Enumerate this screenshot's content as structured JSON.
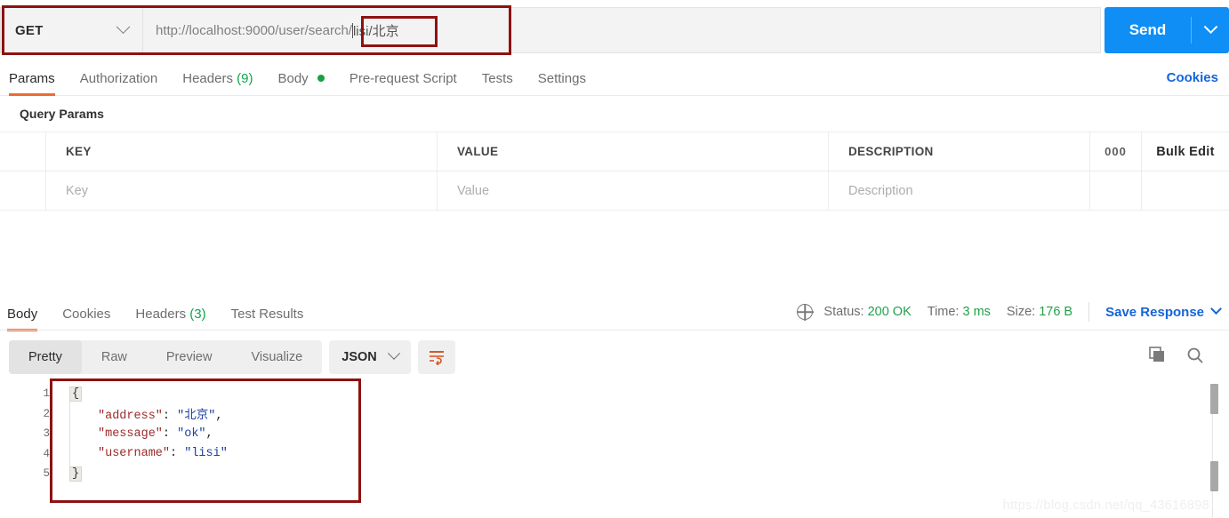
{
  "request": {
    "method": "GET",
    "url_prefix": "http://localhost:9000/user/search/",
    "url_highlight": "lisi/北京",
    "url_full": "http://localhost:9000/user/search/lisi/北京",
    "send_label": "Send",
    "cookies_label": "Cookies",
    "tabs": [
      {
        "label": "Params",
        "active": true,
        "count": "",
        "dot": false
      },
      {
        "label": "Authorization",
        "active": false,
        "count": "",
        "dot": false
      },
      {
        "label": "Headers",
        "active": false,
        "count": "(9)",
        "dot": false
      },
      {
        "label": "Body",
        "active": false,
        "count": "",
        "dot": true
      },
      {
        "label": "Pre-request Script",
        "active": false,
        "count": "",
        "dot": false
      },
      {
        "label": "Tests",
        "active": false,
        "count": "",
        "dot": false
      },
      {
        "label": "Settings",
        "active": false,
        "count": "",
        "dot": false
      }
    ]
  },
  "query_params": {
    "title": "Query Params",
    "columns": [
      "KEY",
      "VALUE",
      "DESCRIPTION"
    ],
    "more_options": "000",
    "bulk_edit": "Bulk Edit",
    "placeholder_row": {
      "key": "Key",
      "value": "Value",
      "description": "Description"
    }
  },
  "response": {
    "tabs": [
      {
        "label": "Body",
        "active": true,
        "count": ""
      },
      {
        "label": "Cookies",
        "active": false,
        "count": ""
      },
      {
        "label": "Headers",
        "active": false,
        "count": "(3)"
      },
      {
        "label": "Test Results",
        "active": false,
        "count": ""
      }
    ],
    "status": {
      "status_label": "Status:",
      "status_value": "200 OK",
      "time_label": "Time:",
      "time_value": "3 ms",
      "size_label": "Size:",
      "size_value": "176 B",
      "save_response": "Save Response"
    },
    "view_modes": [
      {
        "label": "Pretty",
        "active": true
      },
      {
        "label": "Raw",
        "active": false
      },
      {
        "label": "Preview",
        "active": false
      },
      {
        "label": "Visualize",
        "active": false
      }
    ],
    "format": "JSON",
    "body_lines": [
      {
        "n": "1",
        "indent": 0,
        "open": "{",
        "key": "",
        "value": "",
        "comma": ""
      },
      {
        "n": "2",
        "indent": 1,
        "open": "",
        "key": "\"address\"",
        "value": "\"北京\"",
        "comma": ","
      },
      {
        "n": "3",
        "indent": 1,
        "open": "",
        "key": "\"message\"",
        "value": "\"ok\"",
        "comma": ","
      },
      {
        "n": "4",
        "indent": 1,
        "open": "",
        "key": "\"username\"",
        "value": "\"lisi\"",
        "comma": ""
      },
      {
        "n": "5",
        "indent": 0,
        "open": "}",
        "key": "",
        "value": "",
        "comma": ""
      }
    ]
  },
  "watermark": "https://blog.csdn.net/qq_43616898",
  "colors": {
    "accent_orange": "#f06a35",
    "send_blue": "#0f8ef5",
    "link_blue": "#1565d8",
    "status_green": "#22a14a",
    "annotation_red": "#8e1111",
    "json_key": "#9c2a2a",
    "json_string": "#1a3fa0"
  }
}
